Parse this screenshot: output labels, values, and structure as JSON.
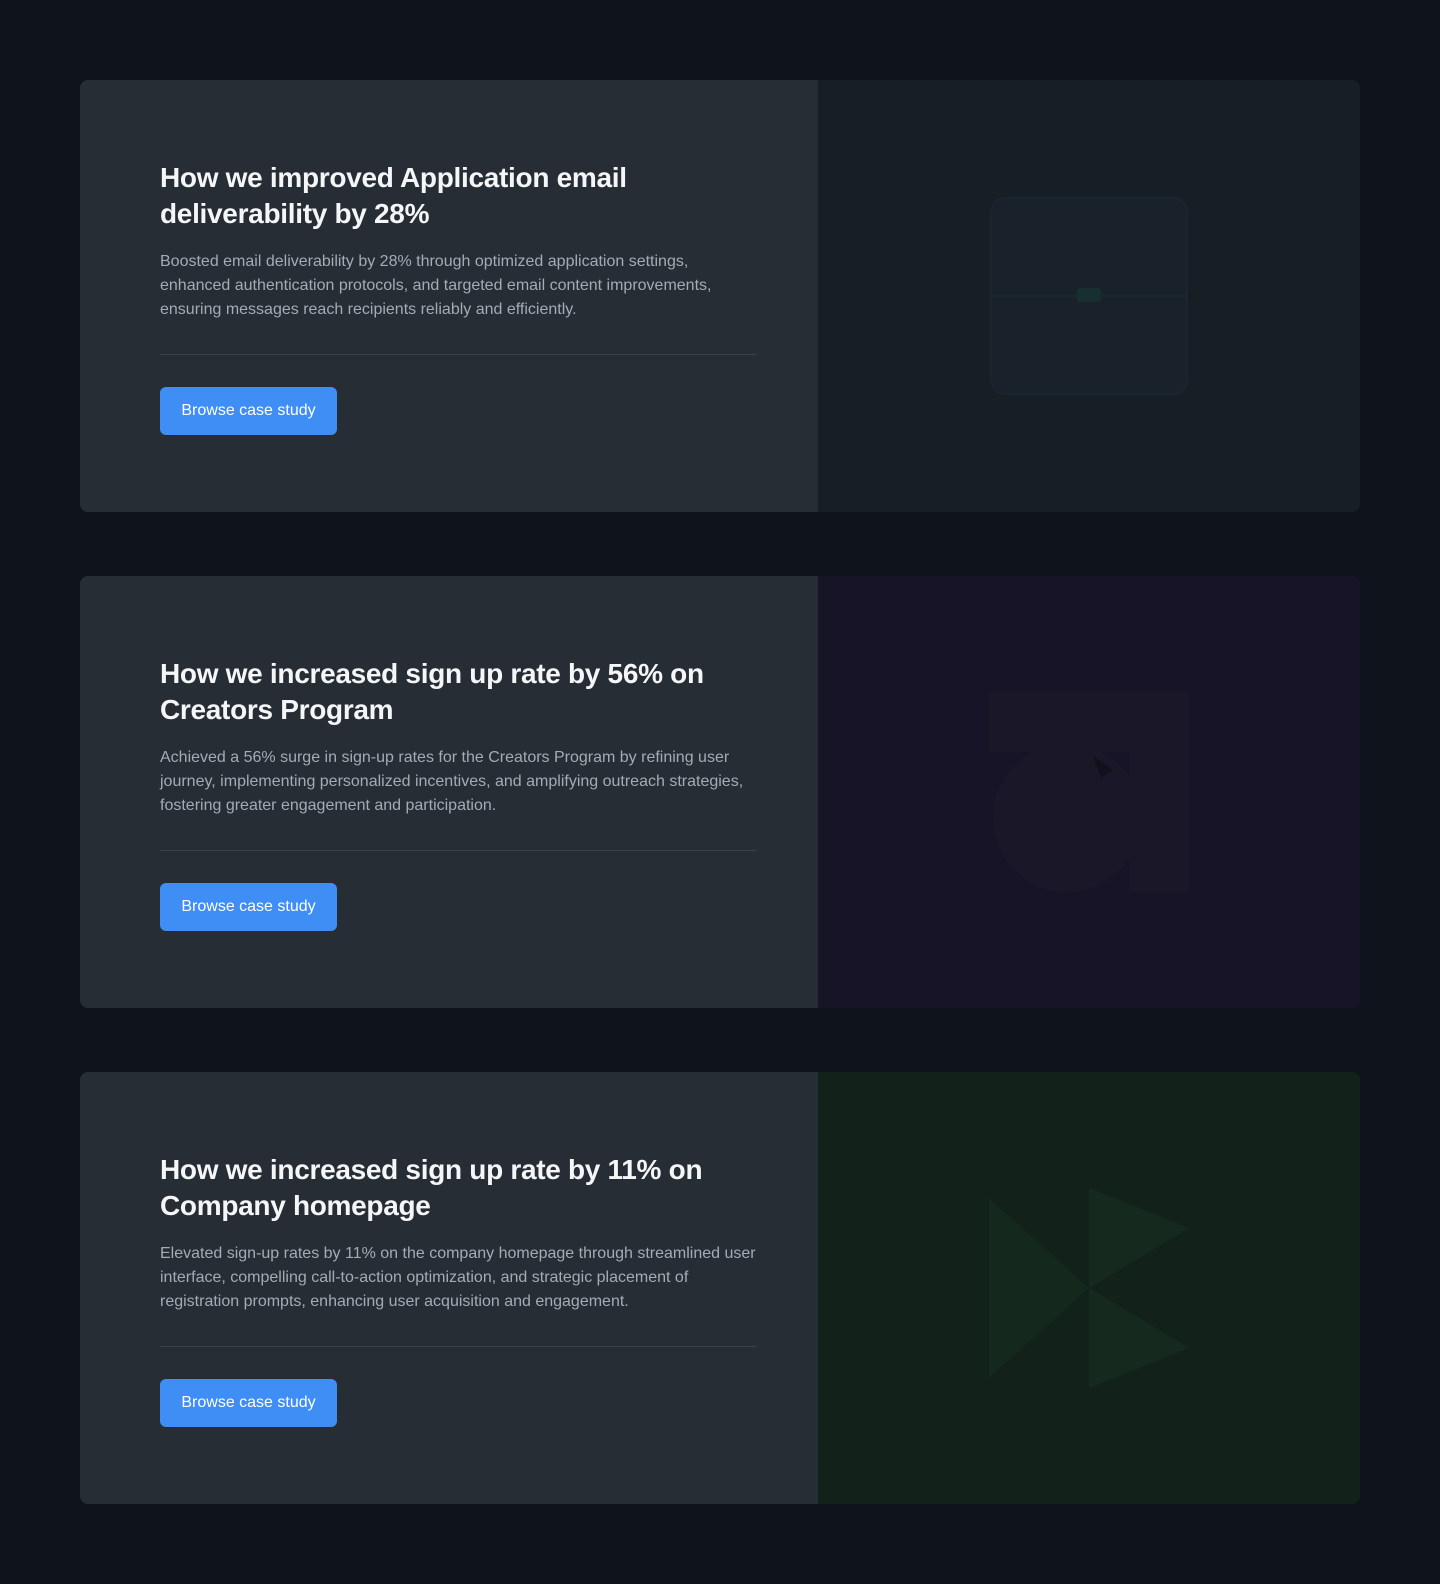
{
  "cards": [
    {
      "title": "How we improved Application email deliverability by 28%",
      "description": "Boosted email deliverability by 28% through optimized application settings, enhanced authentication protocols, and targeted email content improvements, ensuring messages reach recipients reliably and efficiently.",
      "button_label": "Browse case study",
      "image_icon": "email-illustration-icon",
      "panel_color": "#161e26"
    },
    {
      "title": "How we increased sign up rate by 56% on Creators Program",
      "description": "Achieved a 56% surge in sign-up rates for the Creators Program by refining user journey, implementing personalized incentives, and amplifying outreach strategies, fostering greater engagement and participation.",
      "button_label": "Browse case study",
      "image_icon": "shapes-illustration-icon",
      "panel_color": "#171427"
    },
    {
      "title": "How we increased sign up rate by 11% on Company homepage",
      "description": "Elevated sign-up rates by 11% on the company homepage through streamlined user interface, compelling call-to-action optimization, and strategic placement of registration prompts, enhancing user acquisition and engagement.",
      "button_label": "Browse case study",
      "image_icon": "arrows-illustration-icon",
      "panel_color": "#12221b"
    }
  ],
  "colors": {
    "page_bg": "#0e131c",
    "card_bg": "#262d35",
    "accent": "#3f8ef5"
  }
}
